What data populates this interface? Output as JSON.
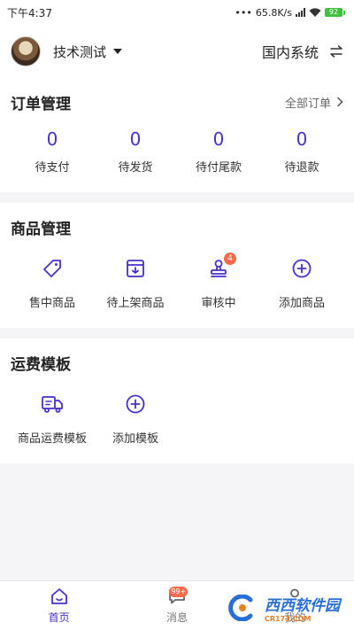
{
  "status_bar": {
    "time": "下午4:37",
    "network_speed": "65.8K/s",
    "battery": "92"
  },
  "header": {
    "user_name": "技术测试",
    "system_label": "国内系统"
  },
  "orders": {
    "title": "订单管理",
    "all_link": "全部订单",
    "items": [
      {
        "count": "0",
        "label": "待支付"
      },
      {
        "count": "0",
        "label": "待发货"
      },
      {
        "count": "0",
        "label": "待付尾款"
      },
      {
        "count": "0",
        "label": "待退款"
      }
    ]
  },
  "products": {
    "title": "商品管理",
    "items": [
      {
        "label": "售中商品",
        "icon": "tag-icon"
      },
      {
        "label": "待上架商品",
        "icon": "download-box-icon"
      },
      {
        "label": "审核中",
        "icon": "stamp-icon",
        "badge": "4"
      },
      {
        "label": "添加商品",
        "icon": "plus-circle-icon"
      }
    ]
  },
  "shipping": {
    "title": "运费模板",
    "items": [
      {
        "label": "商品运费模板",
        "icon": "truck-icon"
      },
      {
        "label": "添加模板",
        "icon": "plus-circle-icon"
      }
    ]
  },
  "tabbar": {
    "items": [
      {
        "label": "首页",
        "icon": "home-icon",
        "active": true
      },
      {
        "label": "消息",
        "icon": "message-icon",
        "badge": "99+"
      },
      {
        "label": "我的",
        "icon": "user-icon"
      }
    ]
  },
  "watermark": {
    "text": "西西软件园",
    "sub": "CR173.COM"
  },
  "colors": {
    "accent": "#4b2fc9",
    "badge": "#f56a4a",
    "background": "#f5f5f7"
  }
}
